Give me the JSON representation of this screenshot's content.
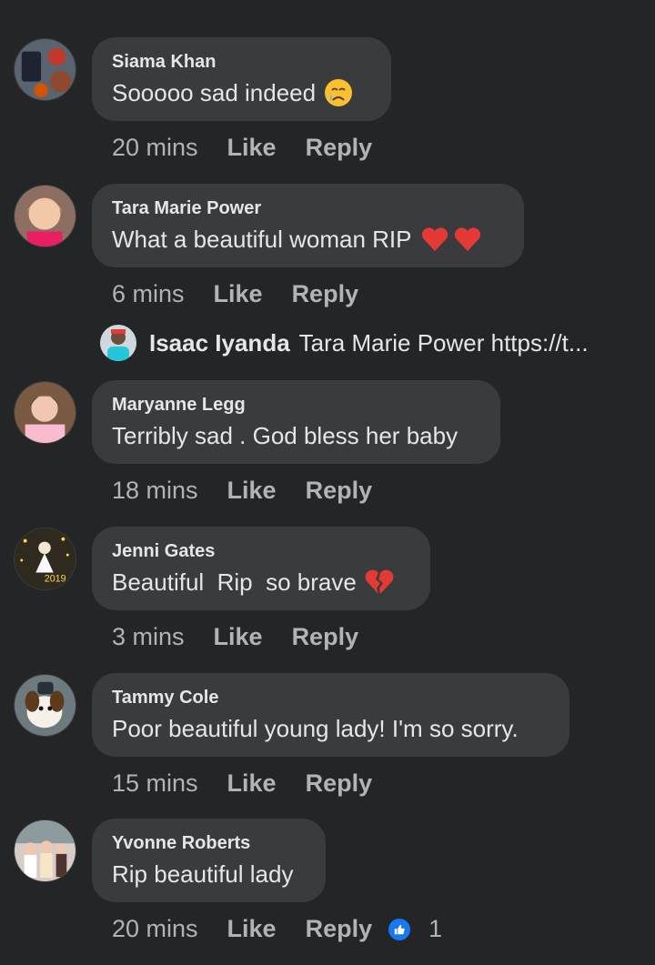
{
  "comments": [
    {
      "author": "Siama Khan",
      "text": "Sooooo sad indeed",
      "emoji": "crying-face-icon",
      "time": "20 mins",
      "like_label": "Like",
      "reply_label": "Reply"
    },
    {
      "author": "Tara Marie Power",
      "text": "What a beautiful woman RIP",
      "emoji": "two-red-hearts-icon",
      "time": "6 mins",
      "like_label": "Like",
      "reply_label": "Reply"
    },
    {
      "author": "Maryanne Legg",
      "text": "Terribly sad . God bless her baby",
      "time": "18 mins",
      "like_label": "Like",
      "reply_label": "Reply"
    },
    {
      "author": "Jenni Gates",
      "text": "Beautiful  Rip  so brave",
      "emoji": "broken-heart-icon",
      "avatar_label": "2019",
      "time": "3 mins",
      "like_label": "Like",
      "reply_label": "Reply"
    },
    {
      "author": "Tammy Cole",
      "text": "Poor beautiful young lady! I'm so sorry.",
      "time": "15 mins",
      "like_label": "Like",
      "reply_label": "Reply"
    },
    {
      "author": "Yvonne Roberts",
      "text": "Rip beautiful lady",
      "time": "20 mins",
      "like_label": "Like",
      "reply_label": "Reply",
      "reaction_icon": "like-thumb-icon",
      "reaction_count": "1"
    }
  ],
  "reply_preview": {
    "author": "Isaac Iyanda",
    "text": "Tara Marie Power https://t..."
  },
  "colors": {
    "background": "#242526",
    "bubble": "#3a3b3c",
    "primary_text": "#e4e6eb",
    "secondary_text": "#b0b3b8",
    "like_blue": "#1877f2"
  }
}
